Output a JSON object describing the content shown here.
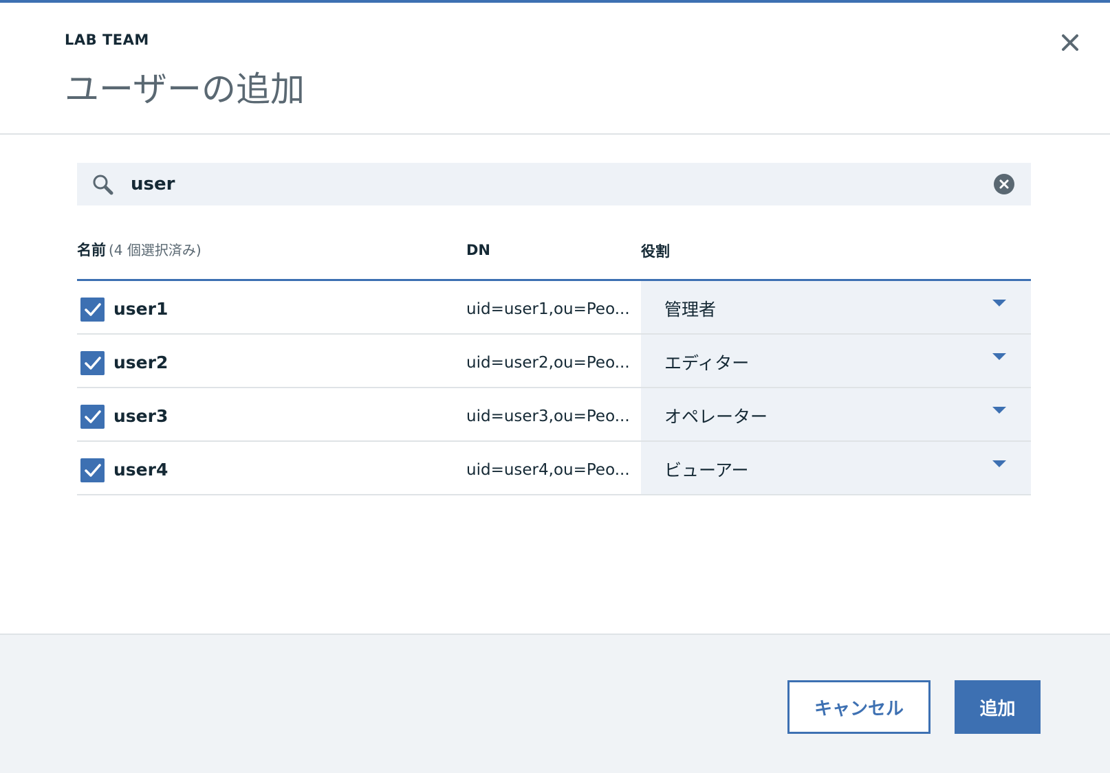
{
  "dialog": {
    "eyebrow": "LAB TEAM",
    "title": "ユーザーの追加",
    "close_icon": "close-icon"
  },
  "search": {
    "value": "user",
    "placeholder": "",
    "icon": "search-icon",
    "clear_icon": "clear-circle-icon"
  },
  "table": {
    "headers": {
      "name": "名前",
      "name_sub": "(4 個選択済み)",
      "dn": "DN",
      "role": "役割"
    },
    "rows": [
      {
        "checked": true,
        "name": "user1",
        "dn": "uid=user1,ou=Peo...",
        "role": "管理者"
      },
      {
        "checked": true,
        "name": "user2",
        "dn": "uid=user2,ou=Peo...",
        "role": "エディター"
      },
      {
        "checked": true,
        "name": "user3",
        "dn": "uid=user3,ou=Peo...",
        "role": "オペレーター"
      },
      {
        "checked": true,
        "name": "user4",
        "dn": "uid=user4,ou=Peo...",
        "role": "ビューアー"
      }
    ]
  },
  "footer": {
    "cancel_label": "キャンセル",
    "add_label": "追加"
  },
  "colors": {
    "accent": "#3d70b2",
    "field_bg": "#eef2f7",
    "footer_bg": "#f0f3f6",
    "text": "#152935",
    "muted": "#5a6872"
  }
}
